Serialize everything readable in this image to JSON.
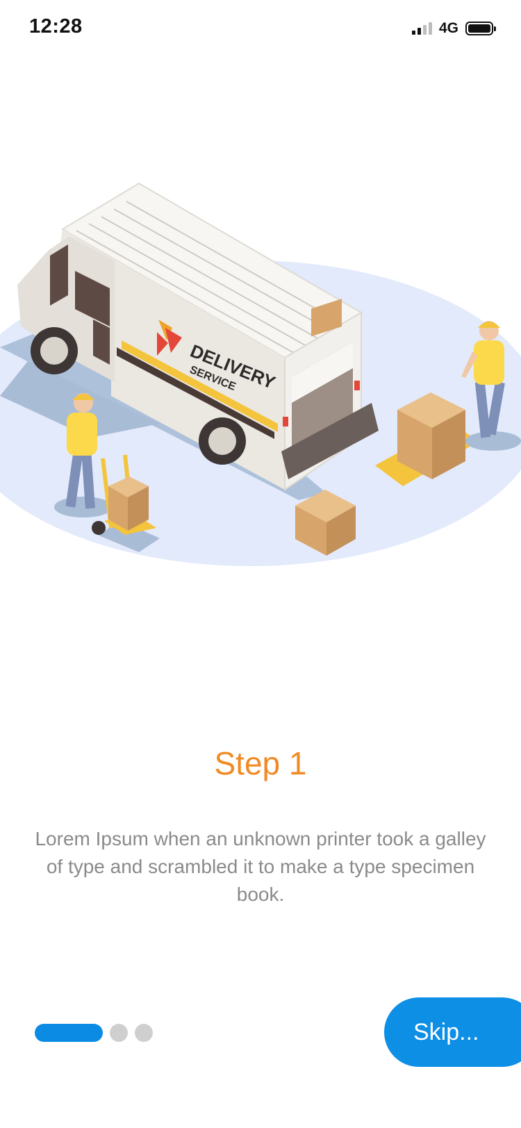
{
  "status_bar": {
    "time": "12:28",
    "network": "4G",
    "icons": [
      "signal-icon",
      "battery-icon"
    ]
  },
  "illustration": {
    "van_brand": "DELIVERY",
    "van_brand_sub": "SERVICE",
    "colors": {
      "floor": "#e2eafb",
      "van_body": "#efece6",
      "worker_shirt": "#fbd94a",
      "box": "#d7a46b"
    }
  },
  "onboarding": {
    "title": "Step 1",
    "description": "Lorem Ipsum when an unknown printer took a galley of type and scrambled it to make a type specimen book.",
    "page_count": 3,
    "active_page": 1
  },
  "actions": {
    "skip_label": "Skip..."
  },
  "colors": {
    "accent": "#f08a24",
    "primary": "#0d8fe6",
    "inactive_dot": "#cfcfcf"
  }
}
